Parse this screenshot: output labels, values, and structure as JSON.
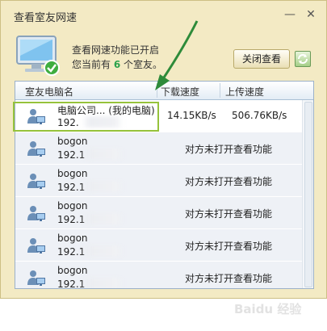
{
  "window": {
    "title": "查看室友网速"
  },
  "info": {
    "line1": "查看网速功能已开启",
    "line2_prefix": "您当前有",
    "count": "6",
    "line2_suffix": "个室友。"
  },
  "buttons": {
    "close_view": "关闭查看"
  },
  "table": {
    "headers": [
      "室友电脑名",
      "下载速度",
      "上传速度"
    ],
    "rows": [
      {
        "name": "电脑公司... (我的电脑)",
        "ip": "192.",
        "download": "14.15KB/s",
        "upload": "506.76KB/s",
        "status": ""
      },
      {
        "name": "bogon",
        "ip": "192.1",
        "download": "",
        "upload": "",
        "status": "对方未打开查看功能"
      },
      {
        "name": "bogon",
        "ip": "192.1",
        "download": "",
        "upload": "",
        "status": "对方未打开查看功能"
      },
      {
        "name": "bogon",
        "ip": "192.1",
        "download": "",
        "upload": "",
        "status": "对方未打开查看功能"
      },
      {
        "name": "bogon",
        "ip": "192.1",
        "download": "",
        "upload": "",
        "status": "对方未打开查看功能"
      },
      {
        "name": "bogon",
        "ip": "192.1",
        "download": "",
        "upload": "",
        "status": "对方未打开查看功能"
      }
    ]
  },
  "watermark": "Baidu 经验",
  "colors": {
    "accent_green": "#96c23b",
    "count_green": "#2aa24b",
    "arrow_green": "#2e8b3a"
  }
}
